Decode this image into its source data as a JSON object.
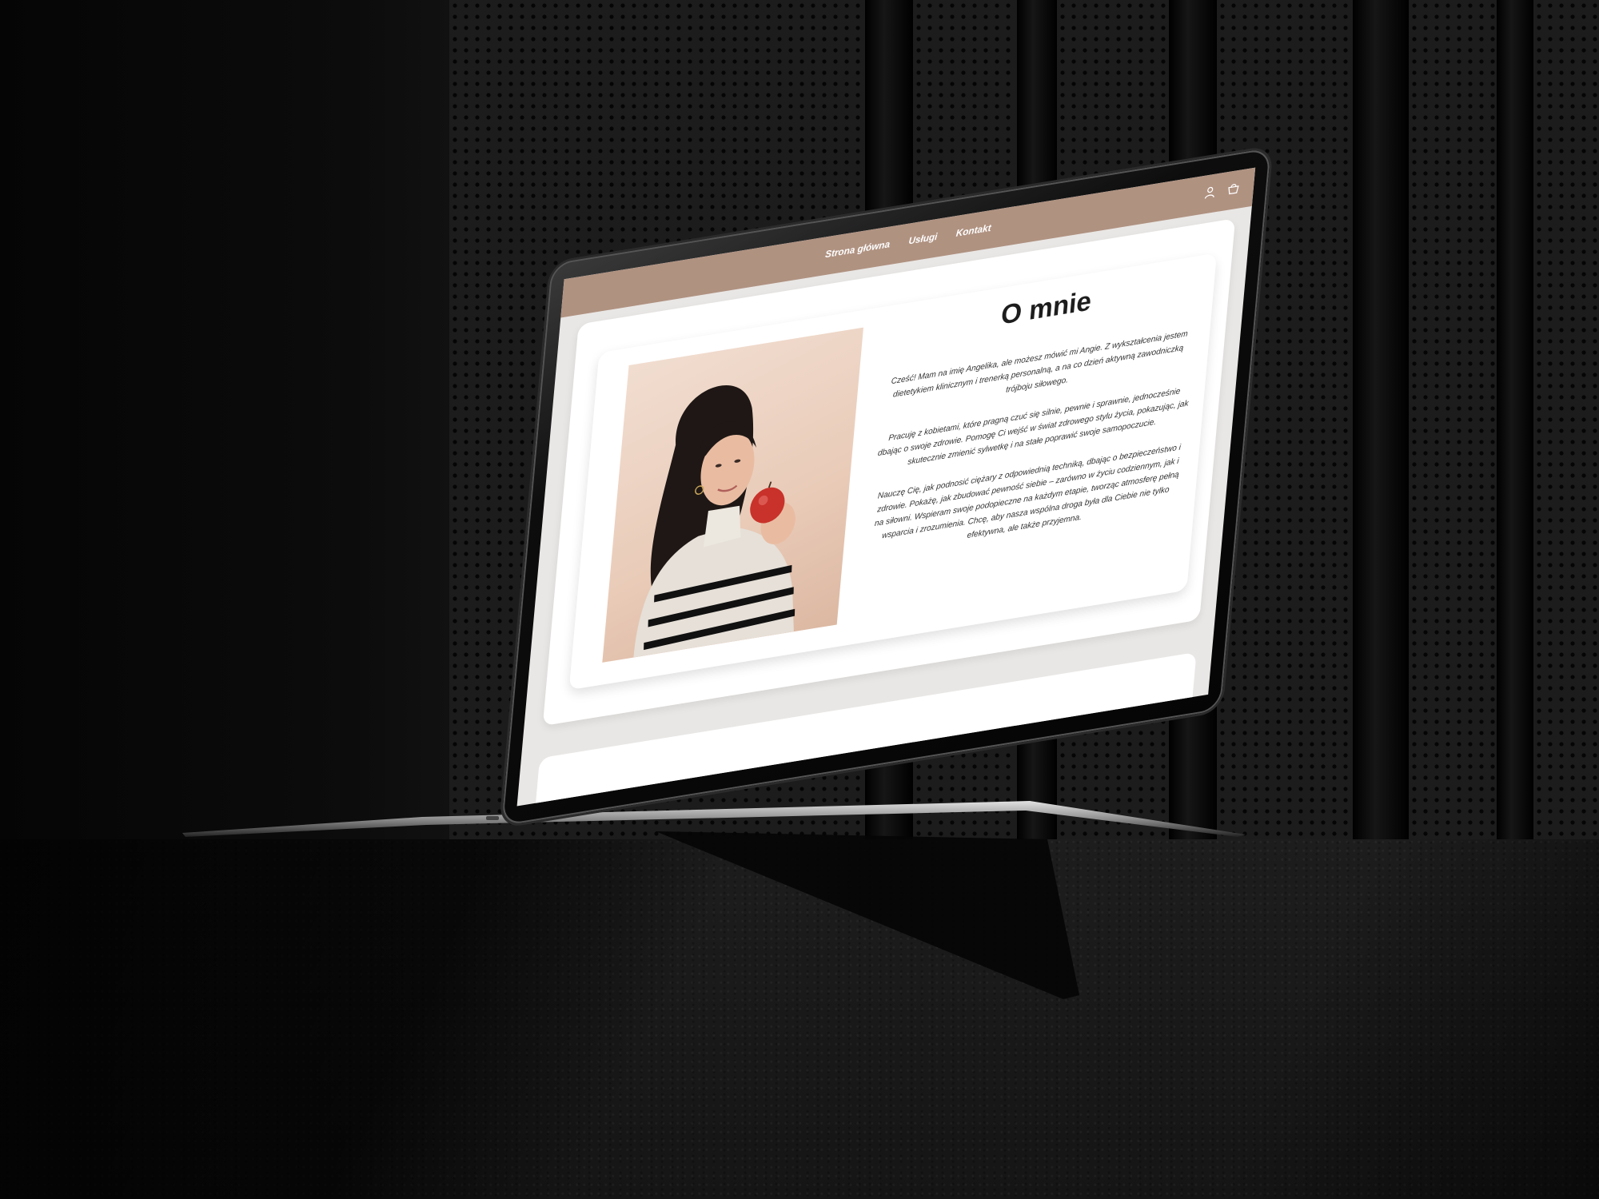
{
  "nav": {
    "items": [
      "Strona główna",
      "Usługi",
      "Kontakt"
    ]
  },
  "header": {
    "icons": [
      "user-icon",
      "basket-icon"
    ],
    "accent_color": "#b09281"
  },
  "about": {
    "title": "O mnie",
    "paragraphs": [
      "Cześć! Mam na imię Angelika, ale możesz mówić mi Angie. Z wykształcenia jestem dietetykiem klinicznym i trenerką personalną, a na co dzień aktywną zawodniczką trójboju siłowego.",
      "Pracuję z kobietami, które pragną czuć się silnie, pewnie i sprawnie, jednocześnie dbając o swoje zdrowie. Pomogę Ci wejść w świat zdrowego stylu życia, pokazując, jak skutecznie zmienić sylwetkę i na stałe poprawić swoje samopoczucie.",
      "Nauczę Cię, jak podnosić ciężary z odpowiednią techniką, dbając o bezpieczeństwo i zdrowie. Pokażę, jak zbudować pewność siebie – zarówno w życiu codziennym, jak i na siłowni. Wspieram swoje podopieczne na każdym etapie, tworząc atmosferę pełną wsparcia i zrozumienia. Chcę, aby nasza wspólna droga była dla Ciebie nie tylko efektywna, ale także przyjemna."
    ]
  }
}
